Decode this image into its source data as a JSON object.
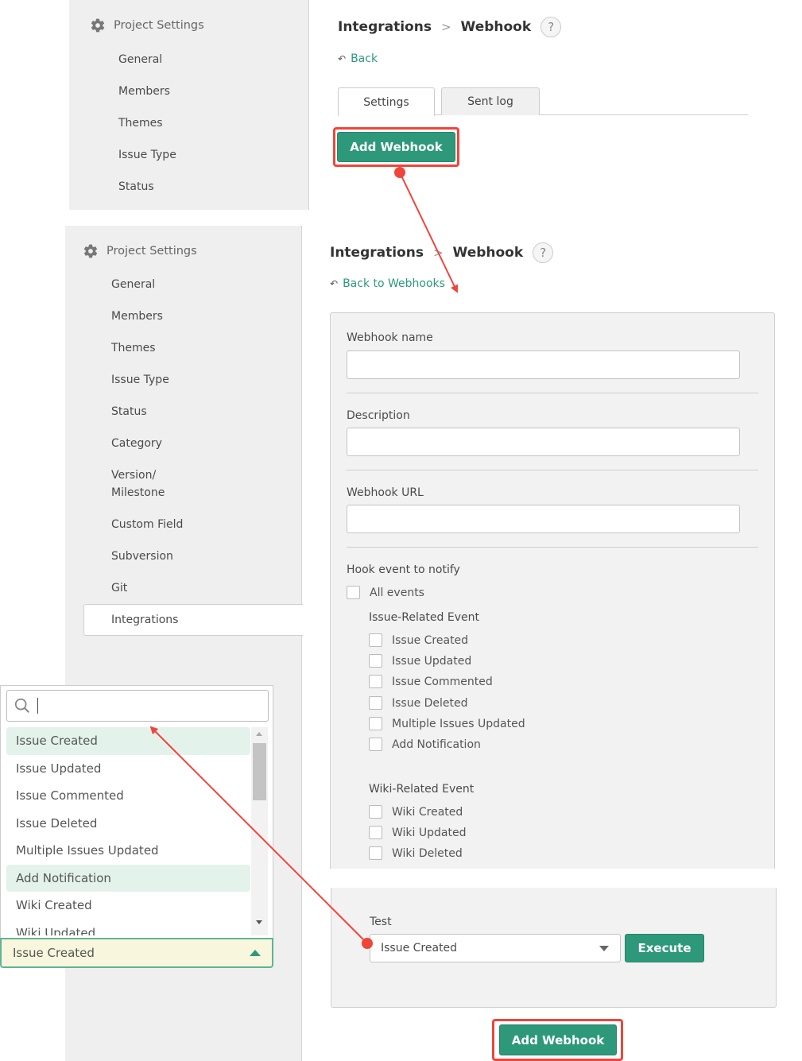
{
  "top_screen": {
    "sidebar": {
      "header": "Project Settings",
      "items": [
        {
          "label": "General"
        },
        {
          "label": "Members"
        },
        {
          "label": "Themes"
        },
        {
          "label": "Issue Type"
        },
        {
          "label": "Status"
        }
      ]
    },
    "breadcrumb": {
      "parent": "Integrations",
      "separator": ">",
      "current": "Webhook",
      "help": "?"
    },
    "back_label": "Back",
    "tabs": [
      {
        "label": "Settings",
        "active": true
      },
      {
        "label": "Sent log",
        "active": false
      }
    ],
    "add_webhook_label": "Add Webhook"
  },
  "bottom_screen": {
    "sidebar": {
      "header": "Project Settings",
      "items": [
        {
          "label": "General"
        },
        {
          "label": "Members"
        },
        {
          "label": "Themes"
        },
        {
          "label": "Issue Type"
        },
        {
          "label": "Status"
        },
        {
          "label": "Category"
        },
        {
          "label": "Version/\nMilestone"
        },
        {
          "label": "Custom Field"
        },
        {
          "label": "Subversion"
        },
        {
          "label": "Git"
        },
        {
          "label": "Integrations",
          "active": true
        }
      ]
    },
    "breadcrumb": {
      "parent": "Integrations",
      "separator": ">",
      "current": "Webhook",
      "help": "?"
    },
    "back_label": "Back to Webhooks",
    "form": {
      "webhook_name": {
        "label": "Webhook name",
        "value": ""
      },
      "description": {
        "label": "Description",
        "value": ""
      },
      "webhook_url": {
        "label": "Webhook URL",
        "value": ""
      },
      "hook_event_label": "Hook event to notify",
      "all_events": {
        "label": "All events",
        "checked": false
      },
      "issue_group": {
        "title": "Issue-Related Event",
        "events": [
          {
            "label": "Issue Created",
            "checked": false
          },
          {
            "label": "Issue Updated",
            "checked": false
          },
          {
            "label": "Issue Commented",
            "checked": false
          },
          {
            "label": "Issue Deleted",
            "checked": false
          },
          {
            "label": "Multiple Issues Updated",
            "checked": false
          },
          {
            "label": "Add Notification",
            "checked": false
          }
        ]
      },
      "wiki_group": {
        "title": "Wiki-Related Event",
        "events": [
          {
            "label": "Wiki Created",
            "checked": false
          },
          {
            "label": "Wiki Updated",
            "checked": false
          },
          {
            "label": "Wiki Deleted",
            "checked": false
          }
        ]
      },
      "test": {
        "label": "Test",
        "selected": "Issue Created",
        "execute_label": "Execute"
      }
    },
    "add_webhook_label": "Add Webhook"
  },
  "dropdown_popup": {
    "search_value": "",
    "options": [
      {
        "label": "Issue Created",
        "highlighted": true
      },
      {
        "label": "Issue Updated",
        "highlighted": false
      },
      {
        "label": "Issue Commented",
        "highlighted": false
      },
      {
        "label": "Issue Deleted",
        "highlighted": false
      },
      {
        "label": "Multiple Issues Updated",
        "highlighted": false
      },
      {
        "label": "Add Notification",
        "highlighted": true
      },
      {
        "label": "Wiki Created",
        "highlighted": false
      },
      {
        "label": "Wiki Updated",
        "highlighted": false
      }
    ],
    "selected": "Issue Created"
  },
  "colors": {
    "accent_green": "#2d997a",
    "link_green": "#2a9a7c",
    "annotation_red": "#f0453a",
    "sidebar_bg": "#efefef",
    "selected_bg": "#f8f6dc"
  }
}
